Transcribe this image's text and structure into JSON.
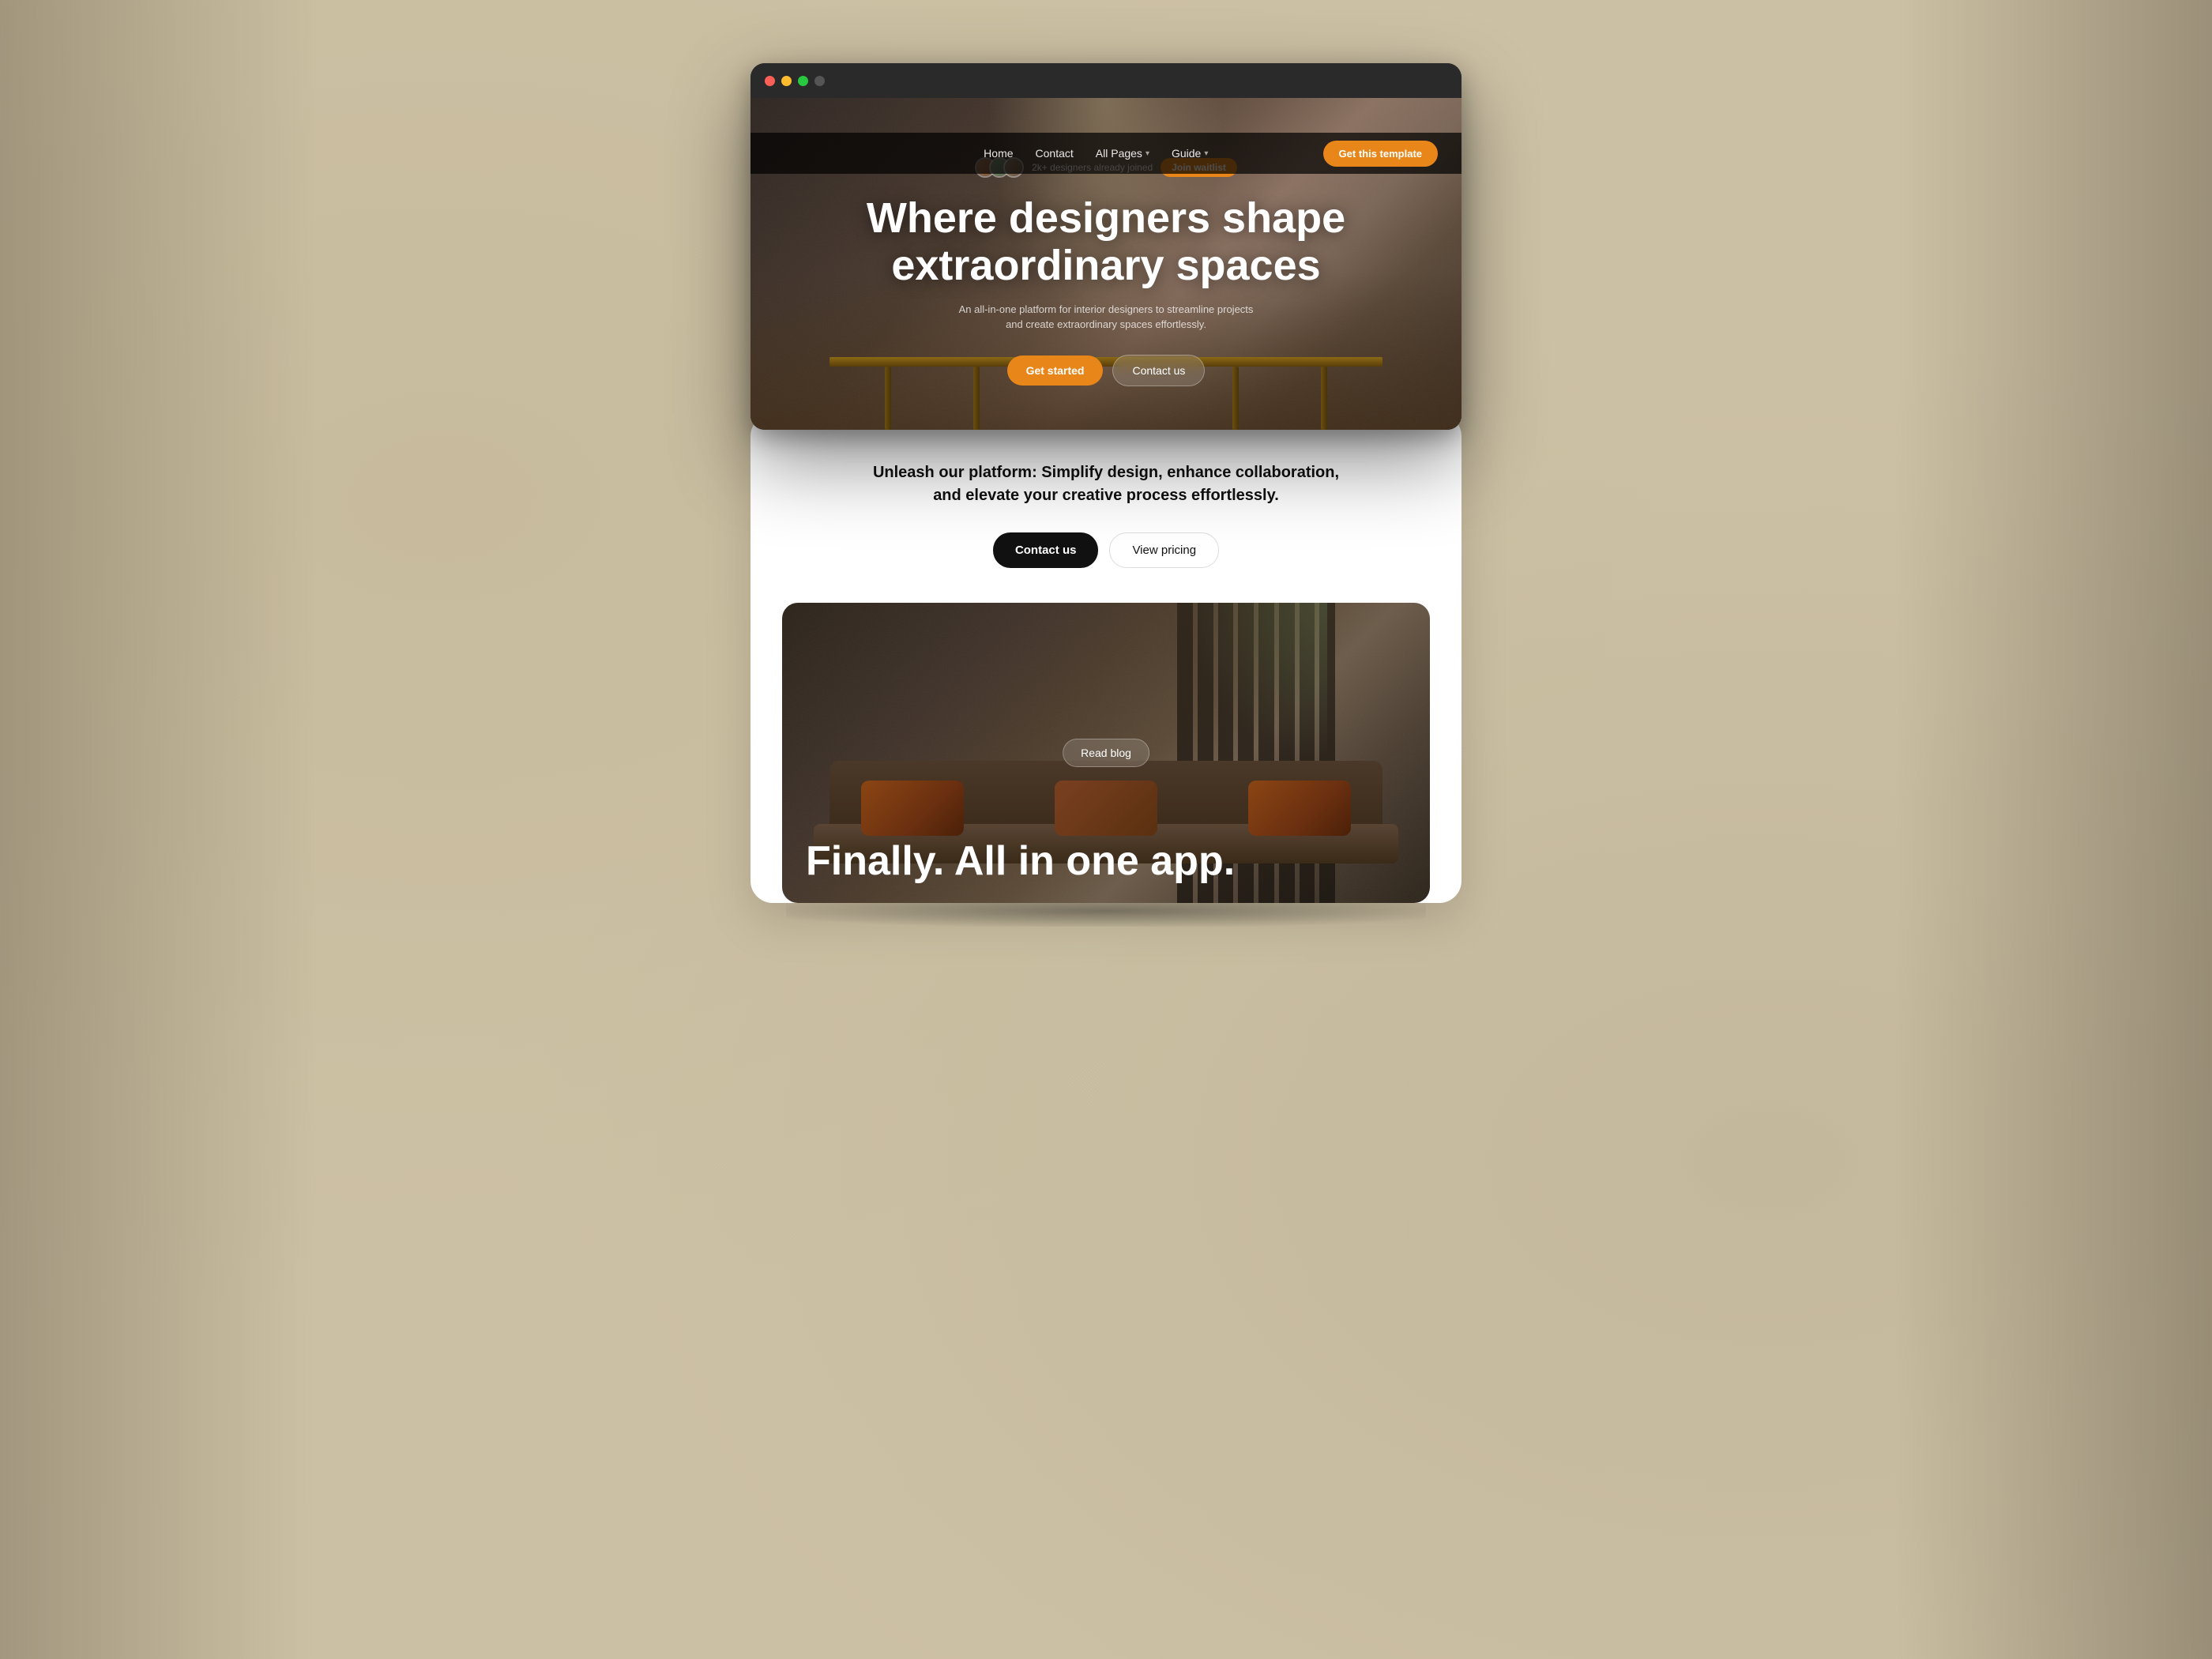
{
  "background": {
    "color": "#d4c9b0"
  },
  "browser": {
    "dots": [
      "red",
      "yellow",
      "green",
      "inactive"
    ],
    "nav": {
      "links": [
        {
          "label": "Home",
          "has_chevron": false
        },
        {
          "label": "Contact",
          "has_chevron": false
        },
        {
          "label": "All Pages",
          "has_chevron": true
        },
        {
          "label": "Guide",
          "has_chevron": true
        }
      ],
      "cta_button": "Get this template"
    }
  },
  "hero": {
    "waitlist_text": "2k+ designers already joined",
    "waitlist_button": "Join waitlist",
    "title_line1": "Where designers shape",
    "title_line2": "extraordinary spaces",
    "subtitle": "An all-in-one platform for interior designers to streamline projects and create extraordinary spaces effortlessly.",
    "button_primary": "Get started",
    "button_secondary": "Contact us"
  },
  "platform_section": {
    "tagline_line1": "Unleash our platform: Simplify design, enhance collaboration,",
    "tagline_line2": "and elevate your creative process effortlessly.",
    "button_contact": "Contact us",
    "button_pricing": "View pricing"
  },
  "interior_section": {
    "read_blog_badge": "Read blog",
    "title": "Finally. All in one app."
  }
}
